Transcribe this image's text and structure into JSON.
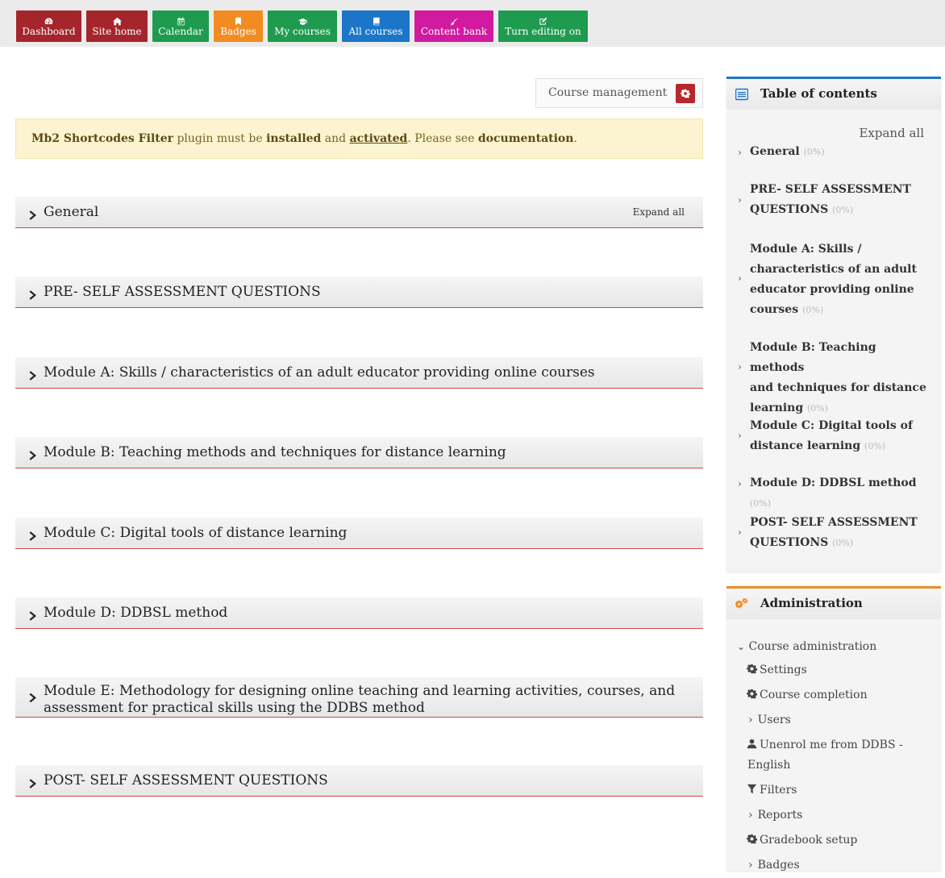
{
  "nav": [
    {
      "label": "Dashboard",
      "icon": "dashboard-icon",
      "color": "#a4262c"
    },
    {
      "label": "Site home",
      "icon": "home-icon",
      "color": "#a4262c"
    },
    {
      "label": "Calendar",
      "icon": "calendar-icon",
      "color": "#1f9b50"
    },
    {
      "label": "Badges",
      "icon": "bookmark-icon",
      "color": "#f28c21"
    },
    {
      "label": "My courses",
      "icon": "graduation-cap-icon",
      "color": "#1f9b50"
    },
    {
      "label": "All courses",
      "icon": "book-icon",
      "color": "#1b76c9"
    },
    {
      "label": "Content bank",
      "icon": "brush-icon",
      "color": "#d11a9f"
    },
    {
      "label": "Turn editing on",
      "icon": "edit-icon",
      "color": "#1f9b50"
    }
  ],
  "course_management": {
    "label": "Course management",
    "color": "#b7272d"
  },
  "alert": {
    "plugin": "Mb2 Shortcodes Filter",
    "t1": " plugin must be ",
    "installed": "installed",
    "t2": " and ",
    "activated": "activated",
    "t3": ". Please see ",
    "documentation": "documentation",
    "t4": "."
  },
  "sections": [
    {
      "title": "General",
      "expand": "Expand all"
    },
    {
      "title": "PRE- SELF ASSESSMENT QUESTIONS"
    },
    {
      "title": "Module A: Skills / characteristics of an adult educator providing online courses"
    },
    {
      "title": "Module B: Teaching methods and techniques for distance learning"
    },
    {
      "title": "Module C: Digital tools of distance learning"
    },
    {
      "title": "Module D: DDBSL method"
    },
    {
      "title": "Module E: Methodology for designing online teaching and learning activities, courses, and assessment for practical skills using the DDBS method"
    },
    {
      "title": "POST- SELF ASSESSMENT QUESTIONS"
    }
  ],
  "toc": {
    "title": "Table of contents",
    "expand": "Expand all",
    "items": [
      {
        "l1": "General",
        "pct": "(0%)"
      },
      {
        "l1": "PRE- SELF ASSESSMENT",
        "l2": "QUESTIONS",
        "pct": "(0%)"
      },
      {
        "l1": "Module A: Skills /",
        "l2": "characteristics of an adult",
        "l3": "educator providing online",
        "l4": "courses",
        "pct": "(0%)"
      },
      {
        "l1": "Module B: Teaching methods",
        "l2": "and techniques for distance",
        "l3": "learning",
        "pct": "(0%)"
      },
      {
        "l1": "Module C: Digital tools of",
        "l2": "distance learning",
        "pct": "(0%)"
      },
      {
        "l1": "Module D: DDBSL method",
        "pct": "(0%)"
      },
      {
        "l1": "POST- SELF ASSESSMENT",
        "l2": "QUESTIONS",
        "pct": "(0%)"
      }
    ]
  },
  "admin": {
    "title": "Administration",
    "course_admin": "Course administration",
    "settings": "Settings",
    "completion": "Course completion",
    "users": "Users",
    "unenrol1": "Unenrol me from DDBS -",
    "unenrol2": "English",
    "filters": "Filters",
    "reports": "Reports",
    "gradebook": "Gradebook setup",
    "badges": "Badges"
  },
  "symbols": {
    "chevron_right": "›",
    "chevron_down": "⌄"
  }
}
